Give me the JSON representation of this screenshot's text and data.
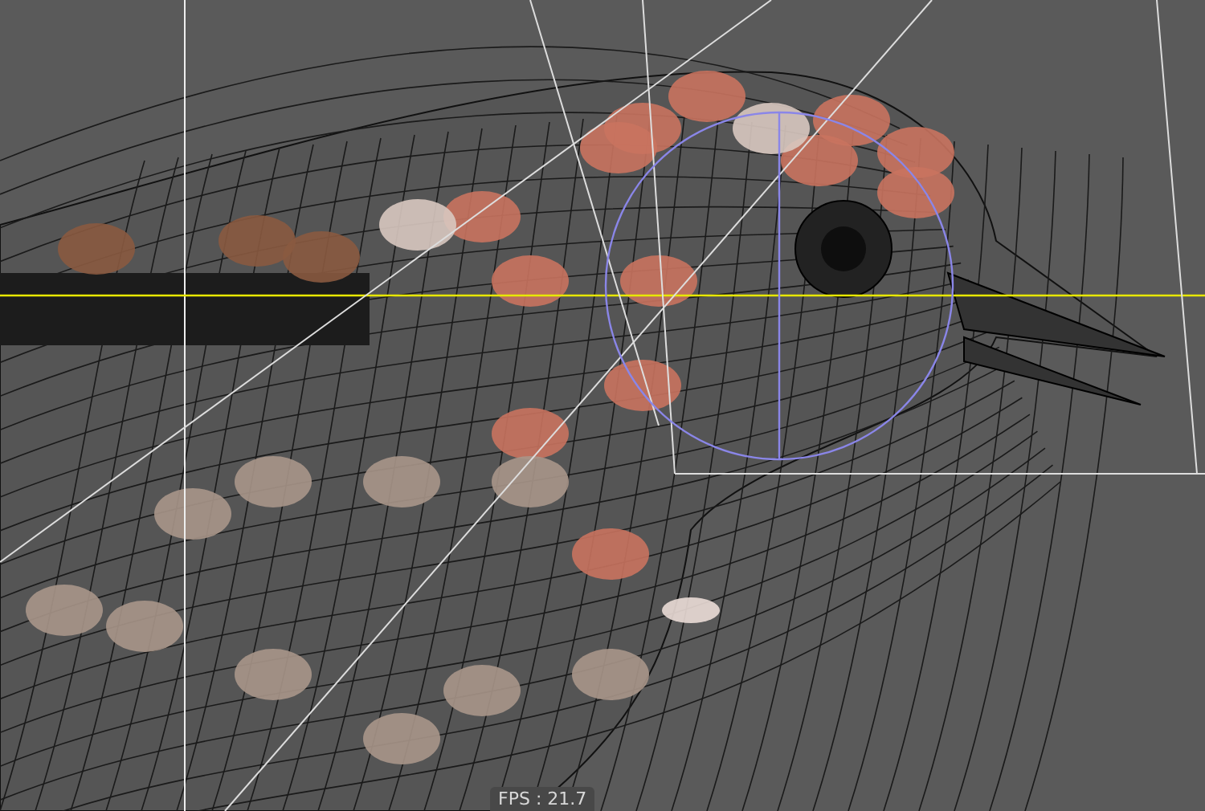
{
  "viewport": {
    "fps_label": "FPS : 21.7"
  }
}
